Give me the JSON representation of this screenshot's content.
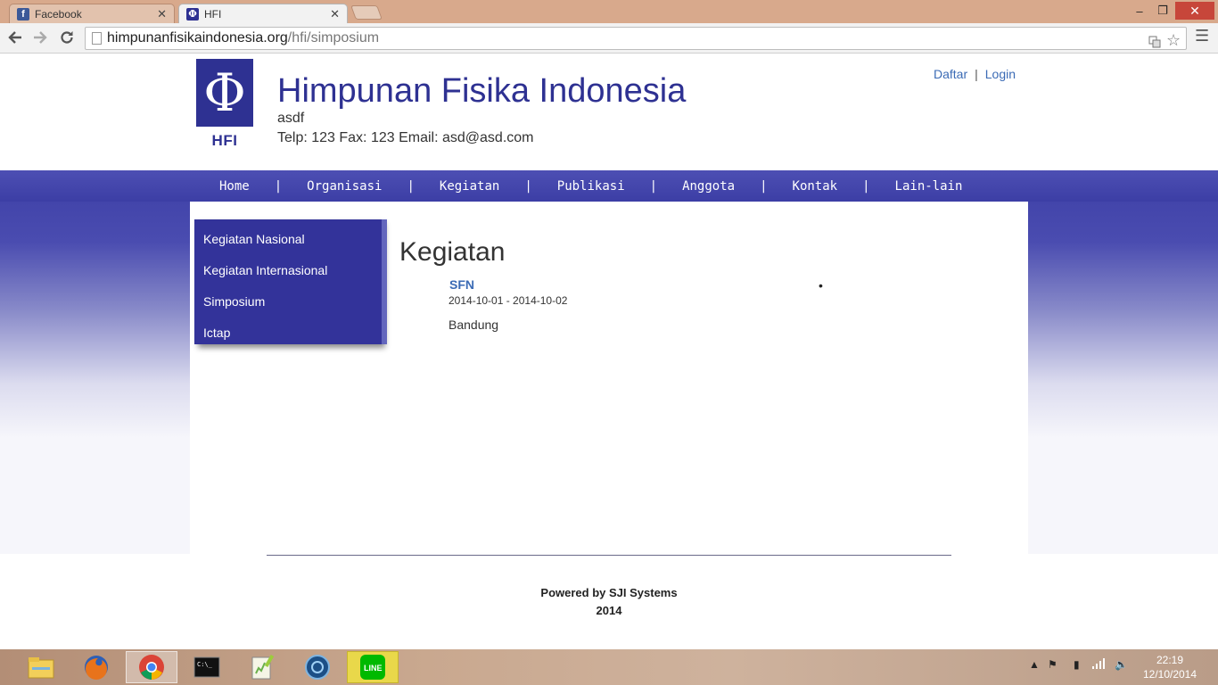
{
  "browser": {
    "tabs": [
      {
        "title": "Facebook",
        "icon": "facebook-icon",
        "active": false
      },
      {
        "title": "HFI",
        "icon": "hfi-favicon",
        "active": true
      }
    ],
    "url_host": "himpunanfisikaindonesia.org",
    "url_path": "/hfi/simposium",
    "window_controls": {
      "minimize": "‒",
      "maximize": "❐",
      "close": "✕"
    }
  },
  "header": {
    "logo_symbol": "Φ",
    "logo_text": "HFI",
    "title": "Himpunan Fisika Indonesia",
    "subtitle": "asdf",
    "contact": "Telp: 123 Fax: 123 Email: asd@asd.com",
    "auth": {
      "register": "Daftar",
      "separator": "|",
      "login": "Login"
    }
  },
  "nav": {
    "items": [
      "Home",
      "Organisasi",
      "Kegiatan",
      "Publikasi",
      "Anggota",
      "Kontak",
      "Lain-lain"
    ],
    "separator": "|"
  },
  "sidebar": {
    "items": [
      "Kegiatan Nasional",
      "Kegiatan Internasional",
      "Simposium",
      "Ictap"
    ]
  },
  "main": {
    "heading": "Kegiatan",
    "event": {
      "title": "SFN",
      "dates": "2014-10-01 - 2014-10-02",
      "location": "Bandung"
    },
    "bullet": "•"
  },
  "footer": {
    "line1": "Powered by SJI Systems",
    "line2": "2014"
  },
  "taskbar": {
    "apps": [
      "file-explorer-icon",
      "firefox-icon",
      "chrome-icon",
      "command-prompt-icon",
      "notepad-plus-plus-icon",
      "app-icon",
      "line-icon"
    ],
    "clock_time": "22:19",
    "clock_date": "12/10/2014"
  },
  "colors": {
    "brand": "#2e3192",
    "link": "#3b6bb5",
    "menu_bg": "#33339a"
  }
}
